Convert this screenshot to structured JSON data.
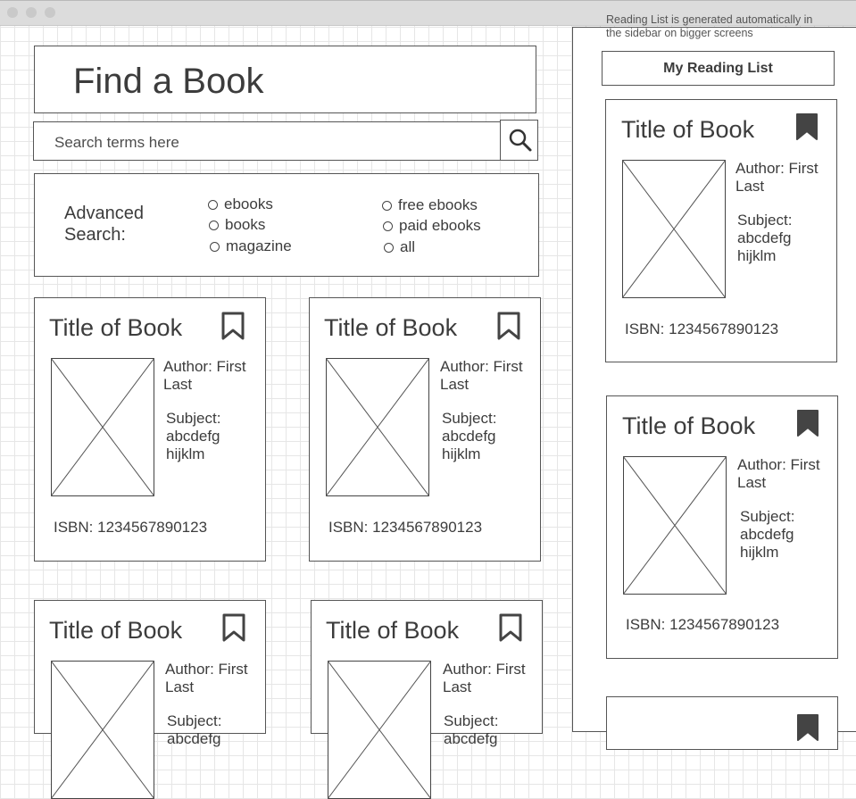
{
  "window": {
    "title": ""
  },
  "header": {
    "title": "Find a Book"
  },
  "search": {
    "placeholder": "Search terms here",
    "button_icon": "search-icon"
  },
  "advanced_search": {
    "label": "Advanced Search:",
    "options_left": [
      "ebooks",
      "books",
      "magazine"
    ],
    "options_right": [
      "free ebooks",
      "paid ebooks",
      "all"
    ]
  },
  "results": [
    {
      "title": "Title of Book",
      "author": "Author: First Last",
      "subject": "Subject: abcdefg hijklm",
      "isbn": "ISBN: 1234567890123"
    },
    {
      "title": "Title of Book",
      "author": "Author: First Last",
      "subject": "Subject: abcdefg hijklm",
      "isbn": "ISBN: 1234567890123"
    },
    {
      "title": "Title of Book",
      "author": "Author: First Last",
      "subject": "Subject: abcdefg",
      "isbn": ""
    },
    {
      "title": "Title of Book",
      "author": "Author: First Last",
      "subject": "Subject: abcdefg",
      "isbn": ""
    }
  ],
  "sidebar": {
    "note": "Reading List is generated automatically in the sidebar on bigger screens",
    "heading": "My Reading List",
    "items": [
      {
        "title": "Title of Book",
        "author": "Author: First Last",
        "subject": "Subject: abcdefg hijklm",
        "isbn": "ISBN: 1234567890123"
      },
      {
        "title": "Title of Book",
        "author": "Author: First Last",
        "subject": "Subject: abcdefg hijklm",
        "isbn": "ISBN: 1234567890123"
      }
    ]
  }
}
